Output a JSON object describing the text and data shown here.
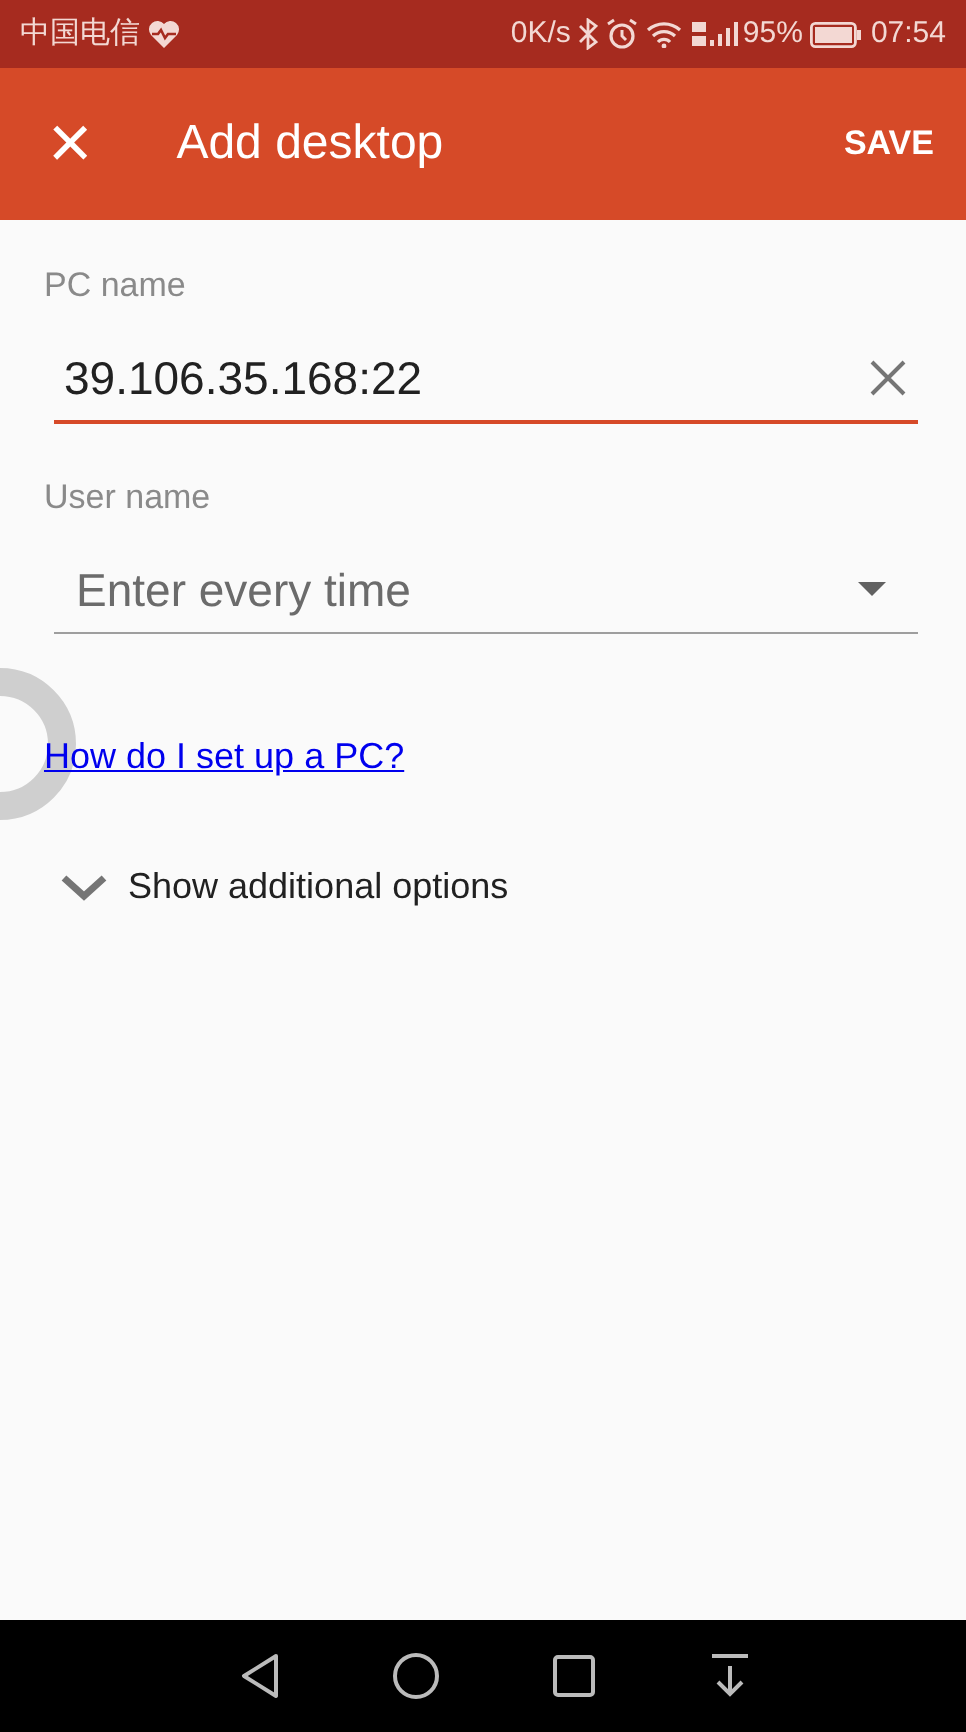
{
  "status_bar": {
    "carrier": "中国电信",
    "speed": "0K/s",
    "battery": "95%",
    "time": "07:54"
  },
  "app_bar": {
    "close": "×",
    "title": "Add desktop",
    "action": "SAVE"
  },
  "form": {
    "pc_name": {
      "label": "PC name",
      "value": "39.106.35.168:22"
    },
    "user_name": {
      "label": "User name",
      "value": "Enter every time"
    },
    "help_link": "How do I set up a PC?",
    "more_options": {
      "label": "Show additional options",
      "expanded": false
    }
  }
}
